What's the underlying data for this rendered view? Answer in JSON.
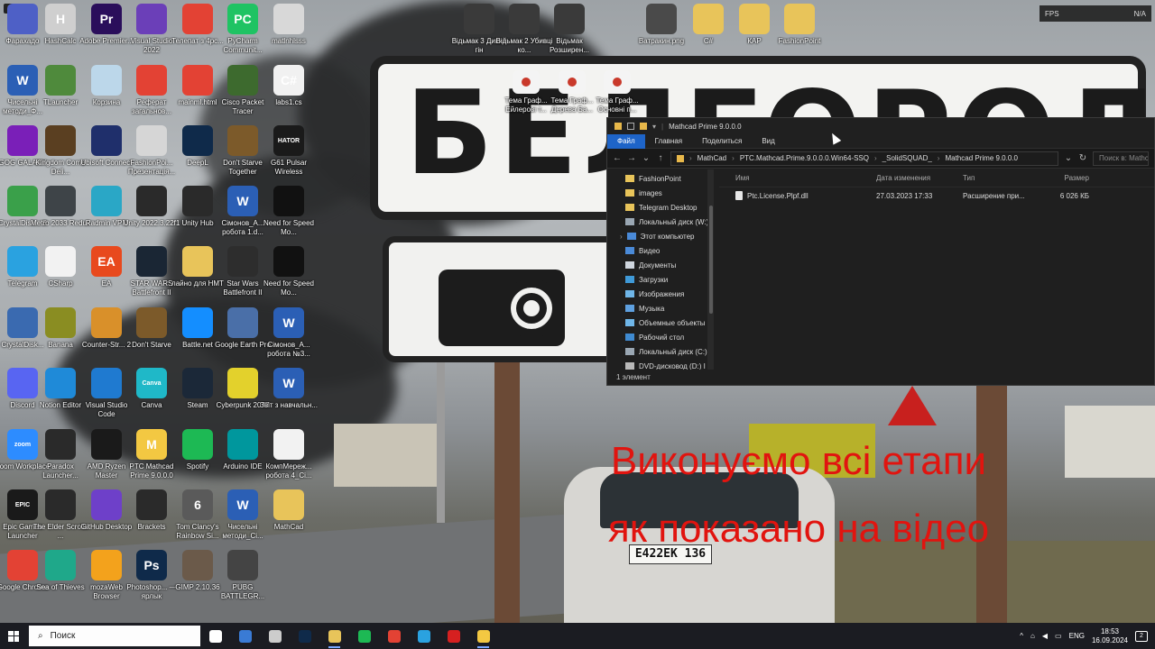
{
  "desktop_icons": [
    {
      "label": "Фарахадо",
      "color": "#4e60c6",
      "glyph": ""
    },
    {
      "label": "HashCalc",
      "color": "#cfcfcf",
      "glyph": "H"
    },
    {
      "label": "Adobe Premier...",
      "color": "#2a0e5b",
      "glyph": "Pr"
    },
    {
      "label": "Visual Studio 2022",
      "color": "#6b3fb8",
      "glyph": ""
    },
    {
      "label": "Телепат з 4pc...",
      "color": "#e34234",
      "glyph": ""
    },
    {
      "label": "PyCharm Communit...",
      "color": "#1fc363",
      "glyph": "PC"
    },
    {
      "label": "matlnhlsss",
      "color": "#d8d8d8",
      "glyph": ""
    },
    {
      "label": "Чисельні методи_Ф...",
      "color": "#2b5fb5",
      "glyph": "W"
    },
    {
      "label": "TLauncher",
      "color": "#4f8a3c",
      "glyph": ""
    },
    {
      "label": "Корзина",
      "color": "#bcd7ea",
      "glyph": ""
    },
    {
      "label": "Реферат загальнов...",
      "color": "#e34234",
      "glyph": ""
    },
    {
      "label": "mainml.html",
      "color": "#e34234",
      "glyph": ""
    },
    {
      "label": "Cisco Packet Tracer",
      "color": "#3d6a2e",
      "glyph": ""
    },
    {
      "label": "labs1.cs",
      "color": "#f1f1f1",
      "glyph": "C#"
    },
    {
      "label": "GOG GALAXY",
      "color": "#7a1fb8",
      "glyph": ""
    },
    {
      "label": "Kingdom Come Deli...",
      "color": "#5a3f21",
      "glyph": ""
    },
    {
      "label": "Ubisoft Connect",
      "color": "#1f2f6b",
      "glyph": ""
    },
    {
      "label": "FashionPoi... Презентація...",
      "color": "#d6d6d6",
      "glyph": ""
    },
    {
      "label": "DeepL",
      "color": "#0f2a4a",
      "glyph": ""
    },
    {
      "label": "Don't Starve Together",
      "color": "#7c5a2a",
      "glyph": ""
    },
    {
      "label": "G61 Pulsar Wireless",
      "color": "#1a1a1a",
      "glyph": "HATOR"
    },
    {
      "label": "CrystalDisk... 8",
      "color": "#3aa04a",
      "glyph": ""
    },
    {
      "label": "Metro 2033 Redux",
      "color": "#3e4448",
      "glyph": ""
    },
    {
      "label": "Radmin VPN",
      "color": "#2aa7c6",
      "glyph": ""
    },
    {
      "label": "Unity 2022.3.22f1",
      "color": "#2a2a2a",
      "glyph": ""
    },
    {
      "label": "Unity Hub",
      "color": "#2a2a2a",
      "glyph": ""
    },
    {
      "label": "Сімонов_А... робота 1.d...",
      "color": "#2b5fb5",
      "glyph": "W"
    },
    {
      "label": "Need for Speed Mo...",
      "color": "#111111",
      "glyph": ""
    },
    {
      "label": "Telegram",
      "color": "#2aa2e0",
      "glyph": ""
    },
    {
      "label": "CSharp",
      "color": "#f2f2f2",
      "glyph": ""
    },
    {
      "label": "EA",
      "color": "#e8491d",
      "glyph": "EA"
    },
    {
      "label": "STAR WARS Battlefront II",
      "color": "#1a2634",
      "glyph": ""
    },
    {
      "label": "лайно для HMT",
      "color": "#e8c45a",
      "glyph": ""
    },
    {
      "label": "Star Wars Battlefront II",
      "color": "#2d2d2d",
      "glyph": ""
    },
    {
      "label": "Need for Speed Mo...",
      "color": "#111111",
      "glyph": ""
    },
    {
      "label": "CrystalDisk...",
      "color": "#3a6ab0",
      "glyph": ""
    },
    {
      "label": "Banana",
      "color": "#8a8d22",
      "glyph": ""
    },
    {
      "label": "Counter-Str... 2",
      "color": "#d9902a",
      "glyph": ""
    },
    {
      "label": "Don't Starve",
      "color": "#7c5a2a",
      "glyph": ""
    },
    {
      "label": "Battle.net",
      "color": "#148eff",
      "glyph": ""
    },
    {
      "label": "Google Earth Pro",
      "color": "#4a6fa8",
      "glyph": ""
    },
    {
      "label": "Сімонов_А... робота №3...",
      "color": "#2b5fb5",
      "glyph": "W"
    },
    {
      "label": "Discord",
      "color": "#5865f2",
      "glyph": ""
    },
    {
      "label": "Notion Editor",
      "color": "#1f8ad8",
      "glyph": ""
    },
    {
      "label": "Visual Studio Code",
      "color": "#1f7ad0",
      "glyph": ""
    },
    {
      "label": "Canva",
      "color": "#1fb8c8",
      "glyph": "Canva"
    },
    {
      "label": "Steam",
      "color": "#1b2838",
      "glyph": ""
    },
    {
      "label": "Cyberpunk 2077",
      "color": "#e3d12c",
      "glyph": ""
    },
    {
      "label": "Звіт з навчальн...",
      "color": "#2b5fb5",
      "glyph": "W"
    },
    {
      "label": "Zoom Workplace",
      "color": "#2d8cff",
      "glyph": "zoom"
    },
    {
      "label": "Paradox Launcher...",
      "color": "#2a2a2a",
      "glyph": ""
    },
    {
      "label": "AMD Ryzen Master",
      "color": "#1a1a1a",
      "glyph": ""
    },
    {
      "label": "PTC Mathcad Prime 9.0.0.0",
      "color": "#f3c842",
      "glyph": "M"
    },
    {
      "label": "Spotify",
      "color": "#1db954",
      "glyph": ""
    },
    {
      "label": "Arduino IDE",
      "color": "#00979d",
      "glyph": ""
    },
    {
      "label": "КомпМереж... робота 4_Ci...",
      "color": "#f2f2f2",
      "glyph": ""
    },
    {
      "label": "Epic Games Launcher",
      "color": "#1a1a1a",
      "glyph": "EPIC"
    },
    {
      "label": "The Elder Scrolls ...",
      "color": "#2a2a2a",
      "glyph": ""
    },
    {
      "label": "GitHub Desktop",
      "color": "#6e40c9",
      "glyph": ""
    },
    {
      "label": "Brackets",
      "color": "#2a2a2a",
      "glyph": ""
    },
    {
      "label": "Tom Clancy's Rainbow Si...",
      "color": "#5a5a5a",
      "glyph": "6"
    },
    {
      "label": "Чисельні методи_Ci...",
      "color": "#2b5fb5",
      "glyph": "W"
    },
    {
      "label": "MathCad",
      "color": "#e8c45a",
      "glyph": ""
    },
    {
      "label": "Google Chrome",
      "color": "#e34234",
      "glyph": ""
    },
    {
      "label": "Sea of Thieves",
      "color": "#1fa88a",
      "glyph": ""
    },
    {
      "label": "mozaWeb Browser",
      "color": "#f3a21c",
      "glyph": ""
    },
    {
      "label": "Photoshop... — ярлык",
      "color": "#0f2a4a",
      "glyph": "Ps"
    },
    {
      "label": "GIMP 2.10.36",
      "color": "#6b5a4a",
      "glyph": ""
    },
    {
      "label": "PUBG BATTLEGR...",
      "color": "#444444",
      "glyph": ""
    }
  ],
  "top_icons": [
    {
      "label": "Відьмак 3 Дикий гін",
      "color": "#3a3a3a"
    },
    {
      "label": "Відьмак 2 Убивці ко...",
      "color": "#3a3a3a"
    },
    {
      "label": "Відьмак Розширен...",
      "color": "#3a3a3a"
    },
    {
      "label": "Ватракин.png",
      "color": "#4a4a4a"
    },
    {
      "label": "C#",
      "color": "#e8c45a"
    },
    {
      "label": "КАР",
      "color": "#e8c45a"
    },
    {
      "label": "FashionPoint",
      "color": "#e8c45a"
    }
  ],
  "pdf_icons": [
    {
      "label": "Тема Граф... Ейлерові т..."
    },
    {
      "label": "Тема Граф... Дерева Ба..."
    },
    {
      "label": "Тема Граф... Основні п..."
    }
  ],
  "recording_time": "01:27",
  "fps": {
    "label": "FPS",
    "value": "N/A"
  },
  "sign": {
    "text": "БЕЛГОРОД",
    "plate": "Е422ЕК 136"
  },
  "overlay": {
    "line1": "Виконуємо всі етапи",
    "line2": "як показано на відео"
  },
  "explorer": {
    "title": "Mathcad Prime 9.0.0.0",
    "tabs": [
      "Файл",
      "Главная",
      "Поделиться",
      "Вид"
    ],
    "breadcrumb": [
      "MathCad",
      "PTC.Mathcad.Prime.9.0.0.0.Win64-SSQ",
      "_SolidSQUAD_",
      "Mathcad Prime 9.0.0.0"
    ],
    "search_placeholder": "Поиск в: Mathcad Prime 9.0.0.0",
    "nav_items": [
      {
        "label": "FashionPoint",
        "icon": "folder",
        "level": 1
      },
      {
        "label": "images",
        "icon": "folder",
        "level": 1
      },
      {
        "label": "Telegram Desktop",
        "icon": "folder",
        "level": 1
      },
      {
        "label": "Локальный диск (W:)",
        "icon": "drive",
        "level": 1
      },
      {
        "label": "Этот компьютер",
        "icon": "pc",
        "level": 0
      },
      {
        "label": "Видео",
        "icon": "video",
        "level": 1
      },
      {
        "label": "Документы",
        "icon": "docs",
        "level": 1
      },
      {
        "label": "Загрузки",
        "icon": "download",
        "level": 1
      },
      {
        "label": "Изображения",
        "icon": "pictures",
        "level": 1
      },
      {
        "label": "Музыка",
        "icon": "music",
        "level": 1
      },
      {
        "label": "Объемные объекты",
        "icon": "3d",
        "level": 1
      },
      {
        "label": "Рабочий стол",
        "icon": "desktop",
        "level": 1
      },
      {
        "label": "Локальный диск (C:)",
        "icon": "drive",
        "level": 1
      },
      {
        "label": "DVD-дисковод (D:) I",
        "icon": "dvd",
        "level": 1
      }
    ],
    "columns": [
      "Имя",
      "Дата изменения",
      "Тип",
      "Размер"
    ],
    "files": [
      {
        "name": "Ptc.License.Plpf.dll",
        "date": "27.03.2023 17:33",
        "type": "Расширение при...",
        "size": "6 026 КБ"
      }
    ],
    "status": "1 элемент"
  },
  "taskbar": {
    "search_label": "Поиск",
    "apps": [
      {
        "name": "task-view",
        "color": "#ffffff"
      },
      {
        "name": "widgets",
        "color": "#3a7bd5"
      },
      {
        "name": "unity",
        "color": "#cccccc"
      },
      {
        "name": "deepl",
        "color": "#0f2a4a"
      },
      {
        "name": "explorer",
        "color": "#e8c45a"
      },
      {
        "name": "spotify",
        "color": "#1db954"
      },
      {
        "name": "chrome",
        "color": "#e34234"
      },
      {
        "name": "telegram",
        "color": "#2aa2e0"
      },
      {
        "name": "amd",
        "color": "#d62020"
      },
      {
        "name": "mathcad",
        "color": "#f3c842"
      }
    ],
    "lang": "ENG",
    "time": "18:53",
    "date": "16.09.2024",
    "notifications": "2"
  }
}
